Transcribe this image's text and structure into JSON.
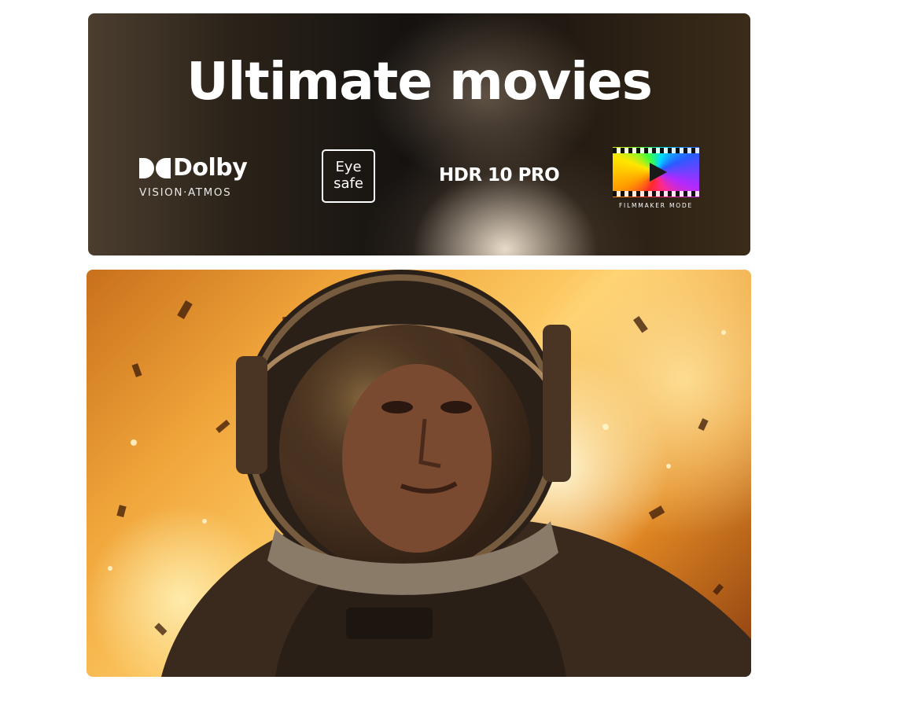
{
  "banner": {
    "title": "Ultimate movies",
    "features": {
      "dolby": {
        "word": "Dolby",
        "sub": "VISION·ATMOS",
        "icon": "dolby-double-d-icon"
      },
      "eye_safe": {
        "line1": "Eye",
        "line2": "safe"
      },
      "hdr": {
        "label": "HDR 10 PRO"
      },
      "filmmaker": {
        "label": "FILMMAKER MODE",
        "icon": "filmmaker-mode-icon"
      }
    }
  },
  "hero": {
    "subject": "astronaut-in-helmet",
    "palette": {
      "fire": "#f0a53a",
      "dark": "#1a120c"
    }
  }
}
